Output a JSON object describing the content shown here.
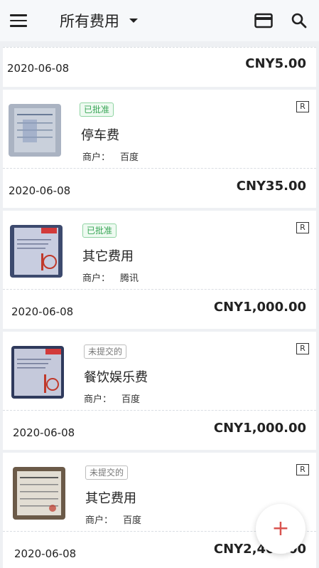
{
  "header": {
    "title": "所有费用",
    "menu_icon": "hamburger-menu-icon",
    "card_icon": "credit-card-icon",
    "search_icon": "search-icon"
  },
  "first_row": {
    "date": "2020-06-08",
    "amount": "CNY5.00"
  },
  "expenses": [
    {
      "status": "已批准",
      "status_type": "approved",
      "r_label": "R",
      "category": "停车费",
      "merchant_label": "商户：",
      "merchant": "百度",
      "date": "2020-06-08",
      "amount": "CNY35.00"
    },
    {
      "status": "已批准",
      "status_type": "approved",
      "r_label": "R",
      "category": "其它费用",
      "merchant_label": "商户：",
      "merchant": "腾讯",
      "date": "2020-06-08",
      "amount": "CNY1,000.00"
    },
    {
      "status": "未提交的",
      "status_type": "draft",
      "r_label": "R",
      "category": "餐饮娱乐费",
      "merchant_label": "商户：",
      "merchant": "百度",
      "date": "2020-06-08",
      "amount": "CNY1,000.00"
    },
    {
      "status": "未提交的",
      "status_type": "draft",
      "r_label": "R",
      "category": "其它费用",
      "merchant_label": "商户：",
      "merchant": "百度",
      "date": "2020-06-08",
      "amount": "CNY2,400.00"
    }
  ],
  "fab": {
    "label": "+",
    "icon": "plus-icon"
  },
  "colors": {
    "approved": "#3aa657",
    "fab_plus": "#d9534f",
    "background": "#eef0f3"
  }
}
